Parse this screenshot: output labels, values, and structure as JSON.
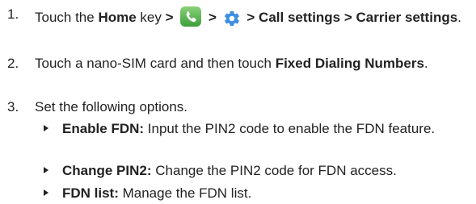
{
  "steps": [
    {
      "number": "1.",
      "touch_the": "Touch the ",
      "home_key": "Home",
      "key_text": " key ",
      "sep1": ">",
      "sep2": ">",
      "path_rest": "> Call settings > Carrier settings",
      "period": "."
    },
    {
      "number": "2.",
      "text_before": "Touch a nano-SIM card and then touch ",
      "bold": "Fixed Dialing Numbers",
      "period": "."
    },
    {
      "number": "3.",
      "text": "Set the following options."
    }
  ],
  "options": [
    {
      "label": "Enable FDN:",
      "desc": " Input the PIN2 code to enable the FDN feature."
    },
    {
      "label": "Change PIN2:",
      "desc": " Change the PIN2 code for FDN access."
    },
    {
      "label": "FDN list:",
      "desc": " Manage the FDN list."
    }
  ],
  "icons": {
    "phone_icon": "phone-app-icon",
    "settings_icon": "gear-icon",
    "phone_color": "#4CAF50",
    "gear_color": "#3F8FE0"
  }
}
